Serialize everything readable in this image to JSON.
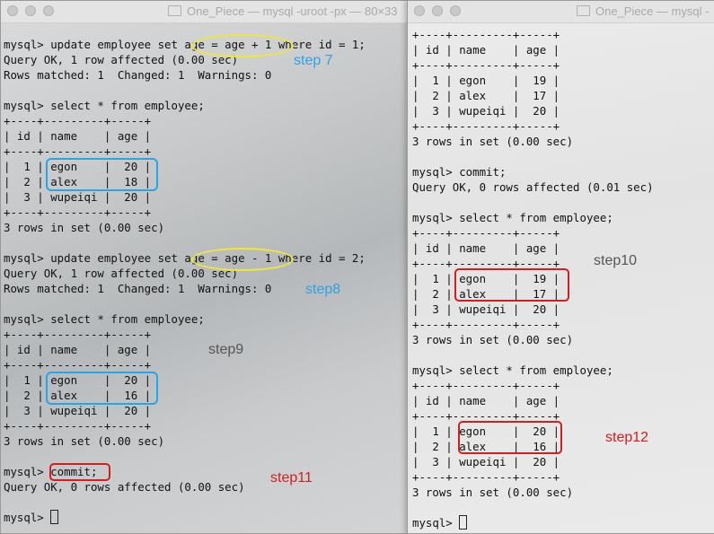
{
  "left_window": {
    "title": "One_Piece — mysql -uroot -px — 80×33",
    "lines": [
      "mysql> update employee set age = age + 1 where id = 1;",
      "Query OK, 1 row affected (0.00 sec)",
      "Rows matched: 1  Changed: 1  Warnings: 0",
      "",
      "mysql> select * from employee;",
      "+----+---------+-----+",
      "| id | name    | age |",
      "+----+---------+-----+",
      "|  1 | egon    |  20 |",
      "|  2 | alex    |  18 |",
      "|  3 | wupeiqi |  20 |",
      "+----+---------+-----+",
      "3 rows in set (0.00 sec)",
      "",
      "mysql> update employee set age = age - 1 where id = 2;",
      "Query OK, 1 row affected (0.00 sec)",
      "Rows matched: 1  Changed: 1  Warnings: 0",
      "",
      "mysql> select * from employee;",
      "+----+---------+-----+",
      "| id | name    | age |",
      "+----+---------+-----+",
      "|  1 | egon    |  20 |",
      "|  2 | alex    |  16 |",
      "|  3 | wupeiqi |  20 |",
      "+----+---------+-----+",
      "3 rows in set (0.00 sec)",
      "",
      "mysql> commit;",
      "Query OK, 0 rows affected (0.00 sec)",
      "",
      "mysql> "
    ]
  },
  "right_window": {
    "title": "One_Piece — mysql -",
    "lines": [
      "+----+---------+-----+",
      "| id | name    | age |",
      "+----+---------+-----+",
      "|  1 | egon    |  19 |",
      "|  2 | alex    |  17 |",
      "|  3 | wupeiqi |  20 |",
      "+----+---------+-----+",
      "3 rows in set (0.00 sec)",
      "",
      "mysql> commit;",
      "Query OK, 0 rows affected (0.01 sec)",
      "",
      "mysql> select * from employee;",
      "+----+---------+-----+",
      "| id | name    | age |",
      "+----+---------+-----+",
      "|  1 | egon    |  19 |",
      "|  2 | alex    |  17 |",
      "|  3 | wupeiqi |  20 |",
      "+----+---------+-----+",
      "3 rows in set (0.00 sec)",
      "",
      "mysql> select * from employee;",
      "+----+---------+-----+",
      "| id | name    | age |",
      "+----+---------+-----+",
      "|  1 | egon    |  20 |",
      "|  2 | alex    |  16 |",
      "|  3 | wupeiqi |  20 |",
      "+----+---------+-----+",
      "3 rows in set (0.00 sec)",
      "",
      "mysql> "
    ]
  },
  "annotations": {
    "step7": "step 7",
    "step8": "step8",
    "step9": "step9",
    "step10": "step10",
    "step11": "step11",
    "step12": "step12"
  },
  "colors": {
    "blue_label": "#2aa2e6",
    "red_label": "#d11e1e",
    "yellow_highlight": "#f1e63a",
    "blue_box": "#26a6ea"
  }
}
